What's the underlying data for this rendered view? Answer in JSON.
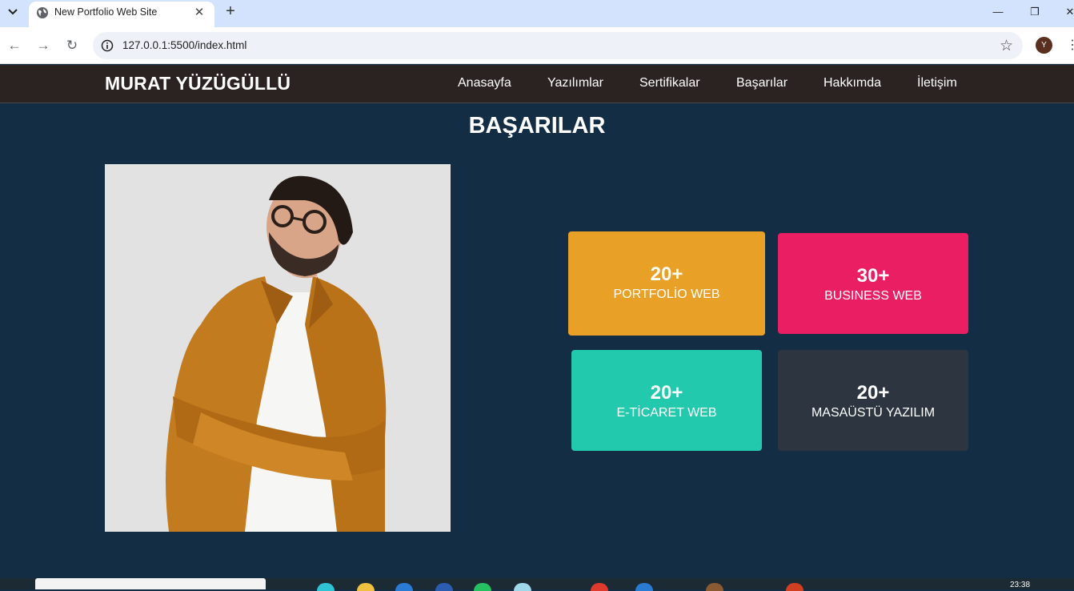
{
  "browser": {
    "tab_title": "New Portfolio Web Site",
    "url": "127.0.0.1:5500/index.html",
    "profile_initial": "Y"
  },
  "site": {
    "brand": "MURAT YÜZÜGÜLLÜ",
    "nav": [
      "Anasayfa",
      "Yazılımlar",
      "Sertifikalar",
      "Başarılar",
      "Hakkımda",
      "İletişim"
    ]
  },
  "section": {
    "title": "BAŞARILAR"
  },
  "achievements": [
    {
      "count": "20+",
      "label": "PORTFOLİO WEB",
      "color": "#e8a027"
    },
    {
      "count": "30+",
      "label": "BUSINESS WEB",
      "color": "#e91e63"
    },
    {
      "count": "20+",
      "label": "E-TİCARET WEB",
      "color": "#22c9ad"
    },
    {
      "count": "20+",
      "label": "MASAÜSTÜ YAZILIM",
      "color": "#2d3640"
    }
  ],
  "taskbar": {
    "clock": "23:38"
  }
}
